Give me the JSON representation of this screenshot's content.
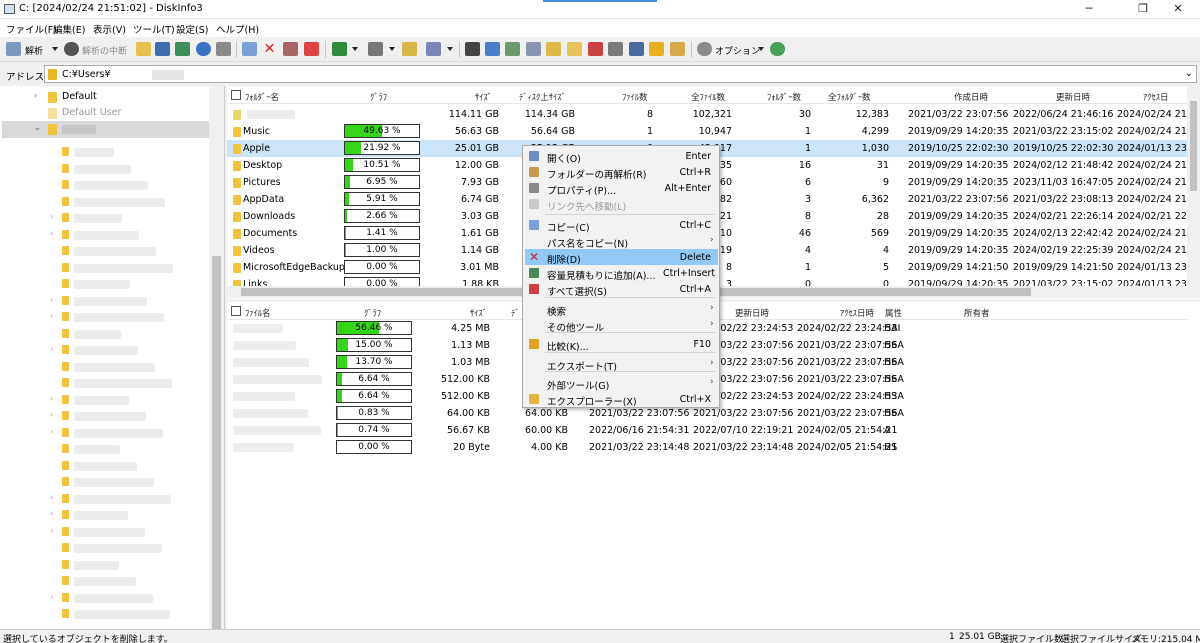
{
  "window": {
    "title": "C: [2024/02/24 21:51:02] - DiskInfo3",
    "minimize": "─",
    "maximize": "❐",
    "close": "✕"
  },
  "menu": [
    "ファイル(F)",
    "編集(E)",
    "表示(V)",
    "ツール(T)",
    "設定(S)",
    "ヘルプ(H)"
  ],
  "toolbar": {
    "analyze": "解析",
    "stop": "解析の中断",
    "options": "オプション"
  },
  "address": {
    "label": "アドレス",
    "value": "C:¥Users¥"
  },
  "tree": {
    "default": "Default",
    "default_user": "Default User"
  },
  "upper": {
    "headers": {
      "name": "ﾌｫﾙﾀﾞｰ名",
      "graph": "ｸﾞﾗﾌ",
      "size": "ｻｲｽﾞ",
      "disk": "ﾃﾞｨｽｸ上ｻｲｽﾞ",
      "files": "ﾌｧｲﾙ数",
      "total_files": "全ﾌｧｲﾙ数",
      "folders": "ﾌｫﾙﾀﾞｰ数",
      "total_folders": "全ﾌｫﾙﾀﾞｰ数",
      "created": "作成日時",
      "modified": "更新日時",
      "accessed": "ｱｸｾｽ日"
    },
    "rows": [
      {
        "name": "",
        "graph": "",
        "pct": 0,
        "size": "114.11 GB",
        "disk": "114.34 GB",
        "files": "8",
        "total_files": "102,321",
        "folders": "30",
        "total_folders": "12,383",
        "created": "2021/03/22 23:07:56",
        "modified": "2022/06/24 21:46:16",
        "accessed": "2024/02/24 21:5"
      },
      {
        "name": "Music",
        "graph": "49.63 %",
        "pct": 49.63,
        "size": "56.63 GB",
        "disk": "56.64 GB",
        "files": "1",
        "total_files": "10,947",
        "folders": "1",
        "total_folders": "4,299",
        "created": "2019/09/29 14:20:35",
        "modified": "2021/03/22 23:15:02",
        "accessed": "2024/02/24 21:5"
      },
      {
        "name": "Apple",
        "graph": "21.92 %",
        "pct": 21.92,
        "size": "25.01 GB",
        "disk": "25.12 GB",
        "files": "0",
        "total_files": "43,017",
        "folders": "1",
        "total_folders": "1,030",
        "created": "2019/10/25 22:02:30",
        "modified": "2019/10/25 22:02:30",
        "accessed": "2024/01/13 23:1"
      },
      {
        "name": "Desktop",
        "graph": "10.51 %",
        "pct": 10.51,
        "size": "12.00 GB",
        "disk": "12.03 GB",
        "files": "17",
        "total_files": "335",
        "folders": "16",
        "total_folders": "31",
        "created": "2019/09/29 14:20:35",
        "modified": "2024/02/12 21:48:42",
        "accessed": "2024/02/24 21:5"
      },
      {
        "name": "Pictures",
        "graph": "6.95 %",
        "pct": 6.95,
        "size": "7.93 GB",
        "disk": "7.94 GB",
        "files": "4",
        "total_files": "560",
        "folders": "6",
        "total_folders": "9",
        "created": "2019/09/29 14:20:35",
        "modified": "2023/11/03 16:47:05",
        "accessed": "2024/02/24 21:5"
      },
      {
        "name": "AppData",
        "graph": "5.91 %",
        "pct": 5.91,
        "size": "6.74 GB",
        "disk": "6.79 GB",
        "files": "0",
        "total_files": "25,382",
        "folders": "3",
        "total_folders": "6,362",
        "created": "2021/03/22 23:07:56",
        "modified": "2021/03/22 23:08:13",
        "accessed": "2024/02/24 21:5"
      },
      {
        "name": "Downloads",
        "graph": "2.66 %",
        "pct": 2.66,
        "size": "3.03 GB",
        "disk": "3.03 GB",
        "files": "12",
        "total_files": "121",
        "folders": "8",
        "total_folders": "28",
        "created": "2019/09/29 14:20:35",
        "modified": "2024/02/21 22:26:14",
        "accessed": "2024/02/21 22:2"
      },
      {
        "name": "Documents",
        "graph": "1.41 %",
        "pct": 1.41,
        "size": "1.61 GB",
        "disk": "1.62 GB",
        "files": "3",
        "total_files": "710",
        "folders": "46",
        "total_folders": "569",
        "created": "2019/09/29 14:20:35",
        "modified": "2024/02/13 22:42:42",
        "accessed": "2024/02/24 21:2"
      },
      {
        "name": "Videos",
        "graph": "1.00 %",
        "pct": 1.0,
        "size": "1.14 GB",
        "disk": "1.14 GB",
        "files": "2",
        "total_files": "19",
        "folders": "4",
        "total_folders": "4",
        "created": "2019/09/29 14:20:35",
        "modified": "2024/02/19 22:25:39",
        "accessed": "2024/02/24 21:5"
      },
      {
        "name": "MicrosoftEdgeBackups",
        "graph": "0.00 %",
        "pct": 0,
        "size": "3.01 MB",
        "disk": "3.02 MB",
        "files": "0",
        "total_files": "8",
        "folders": "1",
        "total_folders": "5",
        "created": "2019/09/29 14:21:50",
        "modified": "2019/09/29 14:21:50",
        "accessed": "2024/01/13 23:1"
      },
      {
        "name": "Links",
        "graph": "0.00 %",
        "pct": 0,
        "size": "1.88 KB",
        "disk": "8.00 KB",
        "files": "2",
        "total_files": "3",
        "folders": "0",
        "total_folders": "0",
        "created": "2019/09/29 14:20:35",
        "modified": "2021/03/22 23:15:02",
        "accessed": "2024/01/13 23:1"
      }
    ]
  },
  "lower": {
    "headers": {
      "name": "ﾌｧｲﾙ名",
      "graph": "ｸﾞﾗﾌ",
      "size": "ｻｲｽﾞ",
      "disk": "ﾃﾞ",
      "created": "作成日時",
      "modified": "更新日時",
      "accessed": "ｱｸｾｽ日時",
      "attr": "属性",
      "owner": "所有者"
    },
    "rows": [
      {
        "graph": "56.46 %",
        "pct": 56.46,
        "size": "4.25 MB",
        "disk": "",
        "created": "",
        "modified": "2024/02/22 23:24:53",
        "accessed": "2024/02/22 23:24:53",
        "attr": "HAI"
      },
      {
        "graph": "15.00 %",
        "pct": 15.0,
        "size": "1.13 MB",
        "disk": "",
        "created": "",
        "modified": "2021/03/22 23:07:56",
        "accessed": "2021/03/22 23:07:56",
        "attr": "HSA"
      },
      {
        "graph": "13.70 %",
        "pct": 13.7,
        "size": "1.03 MB",
        "disk": "",
        "created": "",
        "modified": "2021/03/22 23:07:56",
        "accessed": "2021/03/22 23:07:56",
        "attr": "HSA"
      },
      {
        "graph": "6.64 %",
        "pct": 6.64,
        "size": "512.00 KB",
        "disk": "",
        "created": "",
        "modified": "2021/03/22 23:07:56",
        "accessed": "2021/03/22 23:07:56",
        "attr": "HSA"
      },
      {
        "graph": "6.64 %",
        "pct": 6.64,
        "size": "512.00 KB",
        "disk": "",
        "created": "",
        "modified": "2024/02/22 23:24:53",
        "accessed": "2024/02/22 23:24:53",
        "attr": "HSA"
      },
      {
        "graph": "0.83 %",
        "pct": 0.83,
        "size": "64.00 KB",
        "disk": "64.00 KB",
        "created": "2021/03/22 23:07:56",
        "modified": "2021/03/22 23:07:56",
        "accessed": "2021/03/22 23:07:56",
        "attr": "HSA"
      },
      {
        "graph": "0.74 %",
        "pct": 0.74,
        "size": "56.67 KB",
        "disk": "60.00 KB",
        "created": "2022/06/16 21:54:31",
        "modified": "2022/07/10 22:19:21",
        "accessed": "2024/02/05 21:54:21",
        "attr": "A"
      },
      {
        "graph": "0.00 %",
        "pct": 0,
        "size": "20 Byte",
        "disk": "4.00 KB",
        "created": "2021/03/22 23:14:48",
        "modified": "2021/03/22 23:14:48",
        "accessed": "2024/02/05 21:54:21",
        "attr": "HS"
      }
    ]
  },
  "context_menu": [
    {
      "label": "開く(O)",
      "shortcut": "Enter",
      "icon": "open-icon",
      "color": "#6a8fc6"
    },
    {
      "label": "フォルダーの再解析(R)",
      "shortcut": "Ctrl+R",
      "icon": "reanalyze-icon",
      "color": "#c89a4a"
    },
    {
      "label": "プロパティ(P)...",
      "shortcut": "Alt+Enter",
      "icon": "properties-icon",
      "color": "#8a8a8a"
    },
    {
      "label": "リンク先へ移動(L)",
      "shortcut": "",
      "icon": "link-icon",
      "color": "#c9c9c9",
      "disabled": true
    },
    {
      "label": "コピー(C)",
      "shortcut": "Ctrl+C",
      "icon": "copy-icon",
      "color": "#7aa0d8"
    },
    {
      "label": "パス名をコピー(N)",
      "shortcut": "",
      "icon": "",
      "submenu": true
    },
    {
      "label": "削除(D)",
      "shortcut": "Delete",
      "icon": "delete-icon",
      "color": "#d42020",
      "highlight": true
    },
    {
      "label": "容量見積もりに追加(A)...",
      "shortcut": "Ctrl+Insert",
      "icon": "estimate-icon",
      "color": "#4a8a5a"
    },
    {
      "label": "すべて選択(S)",
      "shortcut": "Ctrl+A",
      "icon": "select-all-icon",
      "color": "#d04040"
    },
    {
      "label": "検索",
      "shortcut": "",
      "icon": "",
      "submenu": true
    },
    {
      "label": "その他ツール",
      "shortcut": "",
      "icon": "",
      "submenu": true
    },
    {
      "label": "比較(K)...",
      "shortcut": "F10",
      "icon": "compare-icon",
      "color": "#e0a020"
    },
    {
      "label": "エクスポート(T)",
      "shortcut": "",
      "icon": "",
      "submenu": true
    },
    {
      "label": "外部ツール(G)",
      "shortcut": "",
      "icon": "",
      "submenu": true
    },
    {
      "label": "エクスプローラー(X)",
      "shortcut": "Ctrl+X",
      "icon": "explorer-icon",
      "color": "#e3b53a"
    }
  ],
  "status": {
    "message": "選択しているオブジェクトを削除します。",
    "count": "1",
    "size": "25.01 GB",
    "files_label": "選択ファイル数",
    "filesize_label": "選択ファイルサイズ",
    "memory": "メモリ:215.04 MB"
  },
  "colors": {
    "graph_fill": "#35d61a",
    "selection": "#cce4f7",
    "menu_highlight": "#91c9f7",
    "accent": "#3b8ee0"
  }
}
